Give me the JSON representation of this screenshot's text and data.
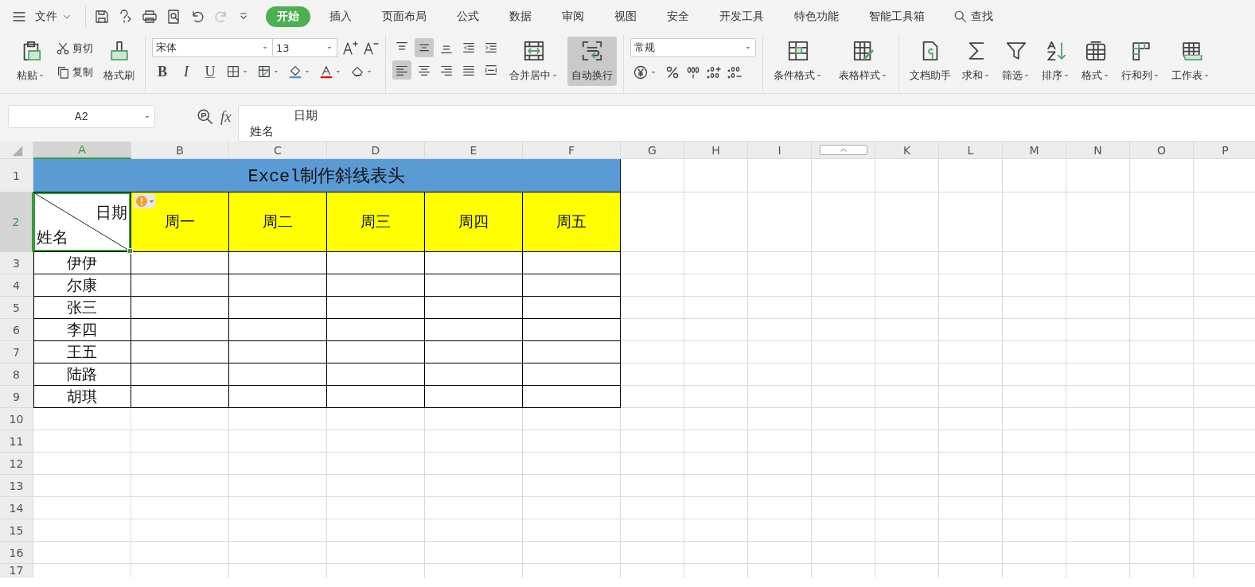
{
  "menu_bar": {
    "file_menu": "文件",
    "tabs": [
      {
        "label": "开始",
        "selected": true
      },
      {
        "label": "插入",
        "selected": false
      },
      {
        "label": "页面布局",
        "selected": false
      },
      {
        "label": "公式",
        "selected": false
      },
      {
        "label": "数据",
        "selected": false
      },
      {
        "label": "审阅",
        "selected": false
      },
      {
        "label": "视图",
        "selected": false
      },
      {
        "label": "安全",
        "selected": false
      },
      {
        "label": "开发工具",
        "selected": false
      },
      {
        "label": "特色功能",
        "selected": false
      },
      {
        "label": "智能工具箱",
        "selected": false
      }
    ],
    "search": "查找"
  },
  "ribbon": {
    "paste": "粘贴",
    "cut": "剪切",
    "copy": "复制",
    "format_painter": "格式刷",
    "font_name": "宋体",
    "font_size": "13",
    "text_styles": [
      "B",
      "I",
      "U"
    ],
    "align_top": [
      {
        "kind": "top",
        "selected": false
      },
      {
        "kind": "middle",
        "selected": true
      },
      {
        "kind": "bottom",
        "selected": false
      },
      {
        "kind": "outdent",
        "selected": false
      },
      {
        "kind": "indent",
        "selected": false
      }
    ],
    "align_bottom": [
      {
        "kind": "left",
        "selected": true
      },
      {
        "kind": "center",
        "selected": false
      },
      {
        "kind": "right",
        "selected": false
      },
      {
        "kind": "justify",
        "selected": false
      },
      {
        "kind": "distribute",
        "selected": false
      }
    ],
    "merge": {
      "label": "合并居中",
      "on": false
    },
    "wrap_text": {
      "label": "自动换行",
      "on": true
    },
    "number_format": "常规",
    "style_tools": [
      {
        "kind": "conditional",
        "label": "条件格式",
        "dropdown": true
      },
      {
        "kind": "table-style",
        "label": "表格样式",
        "dropdown": true
      }
    ],
    "tools": [
      {
        "kind": "doc",
        "label": "文档助手",
        "dropdown": false
      },
      {
        "kind": "sum",
        "label": "求和",
        "dropdown": true
      },
      {
        "kind": "filter",
        "label": "筛选",
        "dropdown": true
      },
      {
        "kind": "sort",
        "label": "排序",
        "dropdown": true
      },
      {
        "kind": "format",
        "label": "格式",
        "dropdown": true
      },
      {
        "kind": "rowcol",
        "label": "行和列",
        "dropdown": true
      },
      {
        "kind": "sheet",
        "label": "工作表",
        "dropdown": true
      }
    ]
  },
  "formula_bar": {
    "cell_ref": "A2",
    "fx": "fx",
    "content": [
      "日期",
      "姓名"
    ]
  },
  "sheet": {
    "columns": [
      {
        "kind": "label",
        "label": "A",
        "selected": true
      },
      {
        "kind": "label",
        "label": "B",
        "selected": false
      },
      {
        "kind": "label",
        "label": "C",
        "selected": false
      },
      {
        "kind": "label",
        "label": "D",
        "selected": false
      },
      {
        "kind": "label",
        "label": "E",
        "selected": false
      },
      {
        "kind": "label",
        "label": "F",
        "selected": false
      },
      {
        "kind": "label",
        "label": "G",
        "selected": false
      },
      {
        "kind": "label",
        "label": "H",
        "selected": false
      },
      {
        "kind": "label",
        "label": "I",
        "selected": false
      },
      {
        "kind": "toggle"
      },
      {
        "kind": "label",
        "label": "K",
        "selected": false
      },
      {
        "kind": "label",
        "label": "L",
        "selected": false
      },
      {
        "kind": "label",
        "label": "M",
        "selected": false
      },
      {
        "kind": "label",
        "label": "N",
        "selected": false
      },
      {
        "kind": "label",
        "label": "O",
        "selected": false
      },
      {
        "kind": "label",
        "label": "P",
        "selected": false
      }
    ],
    "rows": [
      {
        "label": "1",
        "selected": false
      },
      {
        "label": "2",
        "selected": true
      },
      {
        "label": "3",
        "selected": false
      },
      {
        "label": "4",
        "selected": false
      },
      {
        "label": "5",
        "selected": false
      },
      {
        "label": "6",
        "selected": false
      },
      {
        "label": "7",
        "selected": false
      },
      {
        "label": "8",
        "selected": false
      },
      {
        "label": "9",
        "selected": false
      },
      {
        "label": "10",
        "selected": false
      },
      {
        "label": "11",
        "selected": false
      },
      {
        "label": "12",
        "selected": false
      },
      {
        "label": "13",
        "selected": false
      },
      {
        "label": "14",
        "selected": false
      },
      {
        "label": "15",
        "selected": false
      },
      {
        "label": "16",
        "selected": false
      },
      {
        "label": "17",
        "selected": false
      }
    ],
    "title": "Excel制作斜线表头",
    "corner": {
      "top": "日期",
      "bottom": "姓名",
      "selected": true
    },
    "weekdays": [
      "周一",
      "周二",
      "周三",
      "周四",
      "周五"
    ],
    "names": [
      "伊伊",
      "尔康",
      "张三",
      "李四",
      "王五",
      "陆路",
      "胡琪"
    ]
  }
}
